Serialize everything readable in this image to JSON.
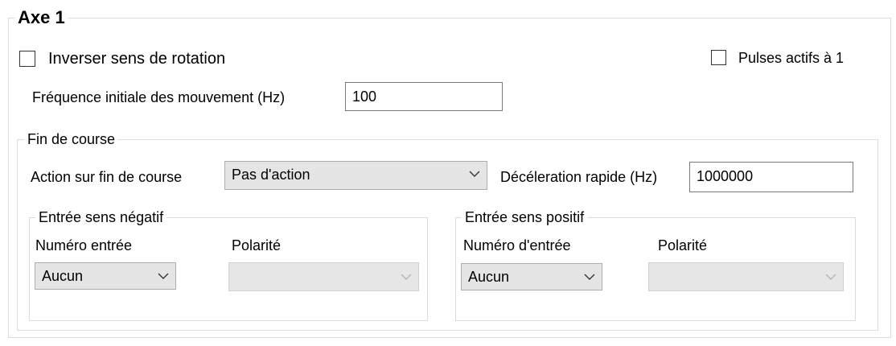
{
  "axe": {
    "title": "Axe 1",
    "invert_rotation": {
      "label": "Inverser sens de rotation",
      "checked": false
    },
    "pulses_active": {
      "label": "Pulses actifs à 1",
      "checked": false
    },
    "initial_frequency": {
      "label": "Fréquence initiale des mouvement (Hz)",
      "value": "100"
    }
  },
  "fin_de_course": {
    "title": "Fin de course",
    "action_label": "Action sur fin de course",
    "action_value": "Pas d'action",
    "decel_label": "Décéleration rapide (Hz)",
    "decel_value": "1000000",
    "negative": {
      "title": "Entrée sens négatif",
      "input_number_label": "Numéro entrée",
      "input_number_value": "Aucun",
      "polarity_label": "Polarité",
      "polarity_value": ""
    },
    "positive": {
      "title": "Entrée sens positif",
      "input_number_label": "Numéro d'entrée",
      "input_number_value": "Aucun",
      "polarity_label": "Polarité",
      "polarity_value": ""
    }
  },
  "colors": {
    "border": "#dcdcdc",
    "combo_bg": "#e5e5e5",
    "disabled_chevron": "#b5b5b5"
  },
  "icons": [
    "chevron-down-icon"
  ]
}
